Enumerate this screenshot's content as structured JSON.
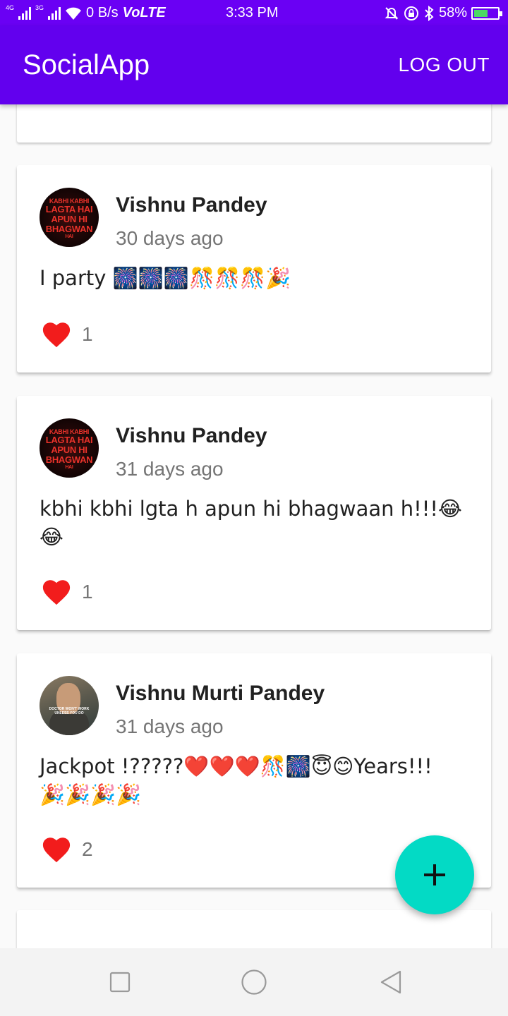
{
  "status_bar": {
    "net_a": "4G",
    "net_b": "3G",
    "speed": "0 B/s",
    "volte": "VoLTE",
    "time": "3:33 PM",
    "battery": "58%",
    "battery_level": 0.58
  },
  "app_bar": {
    "title": "SocialApp",
    "logout_label": "LOG OUT",
    "color": "#6200ee"
  },
  "posts": [
    {
      "author": "Vishnu Pandey",
      "time": "30 days ago",
      "body": "I party 🎆🎆🎆🎊🎊🎊🎉",
      "likes": "1",
      "avatar_text": [
        "KABHI KABHI",
        "LAGTA HAI",
        "APUN HI",
        "BHAGWAN",
        "HAI"
      ]
    },
    {
      "author": "Vishnu Pandey",
      "time": "31 days ago",
      "body": "kbhi kbhi lgta h apun hi bhagwaan h!!!😂😂",
      "likes": "1",
      "avatar_text": [
        "KABHI KABHI",
        "LAGTA HAI",
        "APUN HI",
        "BHAGWAN",
        "HAI"
      ]
    },
    {
      "author": "Vishnu Murti Pandey",
      "time": "31 days ago",
      "body": "Jackpot !?????❤️❤️❤️🎊🎆😇😊Years!!! 🎉🎉🎉🎉",
      "likes": "2",
      "avatar_text": [
        "DOCTOR WON'T WORK",
        "UNLESS YOU DO"
      ]
    }
  ],
  "fab": {
    "icon": "plus-icon",
    "color": "#03dac5"
  },
  "nav": {
    "icons": [
      "recents-square-icon",
      "home-circle-icon",
      "back-triangle-icon"
    ]
  }
}
